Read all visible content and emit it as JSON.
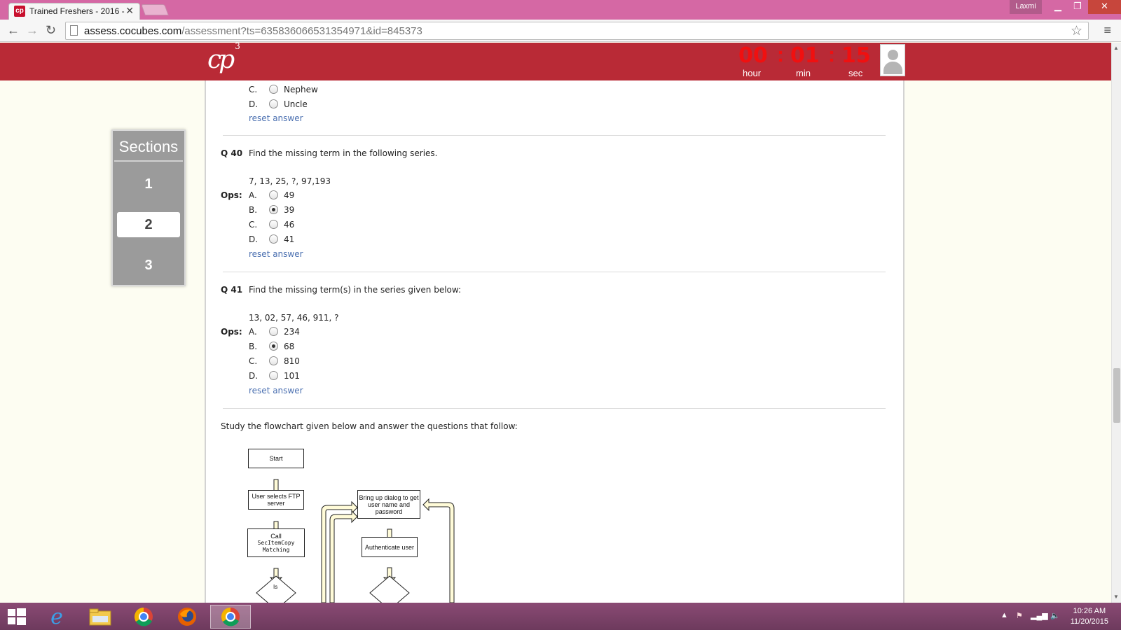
{
  "browser": {
    "tab_title": "Trained Freshers - 2016 - ",
    "tab_close": "✕",
    "user_name": "Laxmi",
    "url_host": "assess.cocubes.com",
    "url_path": "/assessment?ts=635836066531354971&id=845373"
  },
  "header": {
    "logo_text": "cp",
    "logo_sup": "3",
    "timer": {
      "hours": "00",
      "minutes": "01",
      "seconds": "15",
      "hour_label": "hour",
      "min_label": "min",
      "sec_label": "sec"
    }
  },
  "sections": {
    "title": "Sections",
    "items": [
      "1",
      "2",
      "3"
    ],
    "active": "2"
  },
  "prev_question": {
    "options": [
      {
        "letter": "C.",
        "text": "Nephew",
        "selected": false
      },
      {
        "letter": "D.",
        "text": "Uncle",
        "selected": false
      }
    ],
    "reset_label": "reset answer"
  },
  "questions": [
    {
      "number": "Q 40",
      "text": "Find the missing term in the following series.",
      "series": "7, 13, 25, ?, 97,193",
      "ops_label": "Ops:",
      "options": [
        {
          "letter": "A.",
          "text": "49",
          "selected": false
        },
        {
          "letter": "B.",
          "text": "39",
          "selected": true
        },
        {
          "letter": "C.",
          "text": "46",
          "selected": false
        },
        {
          "letter": "D.",
          "text": "41",
          "selected": false
        }
      ],
      "reset_label": "reset answer"
    },
    {
      "number": "Q 41",
      "text": "Find the missing term(s) in the series given below:",
      "series": "13, 02, 57, 46, 911, ?",
      "ops_label": "Ops:",
      "options": [
        {
          "letter": "A.",
          "text": "234",
          "selected": false
        },
        {
          "letter": "B.",
          "text": "68",
          "selected": true
        },
        {
          "letter": "C.",
          "text": "810",
          "selected": false
        },
        {
          "letter": "D.",
          "text": "101",
          "selected": false
        }
      ],
      "reset_label": "reset answer"
    }
  ],
  "passage": {
    "instruction": "Study the flowchart given below and answer the questions that follow:",
    "flowchart": {
      "start": "Start",
      "user_selects": "User selects FTP server",
      "call": "Call",
      "call_fn_1": "SecItemCopy",
      "call_fn_2": "Matching",
      "decision": "Is",
      "dialog": "Bring up dialog to get user name and password",
      "authenticate": "Authenticate user"
    }
  },
  "taskbar": {
    "time": "10:26 AM",
    "date": "11/20/2015"
  },
  "colors": {
    "header_red": "#b92a36",
    "timer_red": "#f01010",
    "titlebar_pink": "#d568a4",
    "link_blue": "#4a6fb0"
  }
}
